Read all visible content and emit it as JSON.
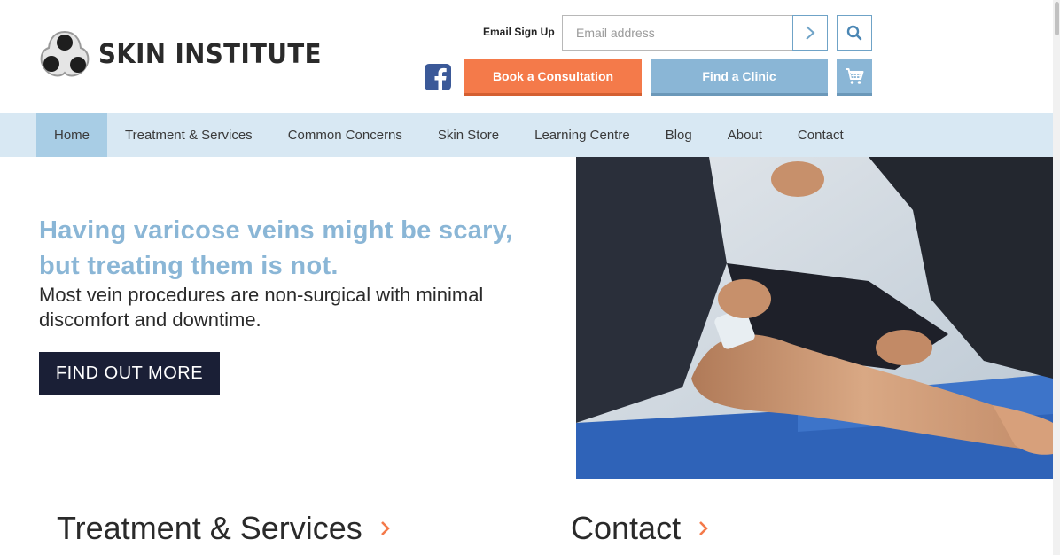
{
  "brand": {
    "name": "SKIN INSTITUTE"
  },
  "header": {
    "email_label": "Email Sign Up",
    "email_placeholder": "Email address",
    "book_label": "Book a Consultation",
    "clinic_label": "Find a Clinic"
  },
  "nav": {
    "items": [
      {
        "label": "Home",
        "active": true
      },
      {
        "label": "Treatment & Services"
      },
      {
        "label": "Common Concerns"
      },
      {
        "label": "Skin Store"
      },
      {
        "label": "Learning Centre"
      },
      {
        "label": "Blog"
      },
      {
        "label": "About"
      },
      {
        "label": "Contact"
      }
    ]
  },
  "hero": {
    "title": "Having varicose veins might be scary, but treating them is not.",
    "subtitle": "Most vein procedures are non-surgical with minimal discomfort and downtime.",
    "cta": "FIND OUT MORE"
  },
  "sections": {
    "treatments": "Treatment & Services",
    "contact": "Contact"
  },
  "icons": {
    "logo": "three-dots-logo-icon",
    "email_submit": "chevron-right-icon",
    "search": "search-icon",
    "facebook": "facebook-icon",
    "cart": "shopping-cart-icon",
    "section_arrow": "chevron-right-icon"
  },
  "colors": {
    "accent_blue": "#8ab6d6",
    "nav_bg": "#d8e8f3",
    "nav_active": "#a8cde5",
    "orange": "#f47a4a",
    "navy": "#1a1f36",
    "facebook": "#3b5998"
  }
}
